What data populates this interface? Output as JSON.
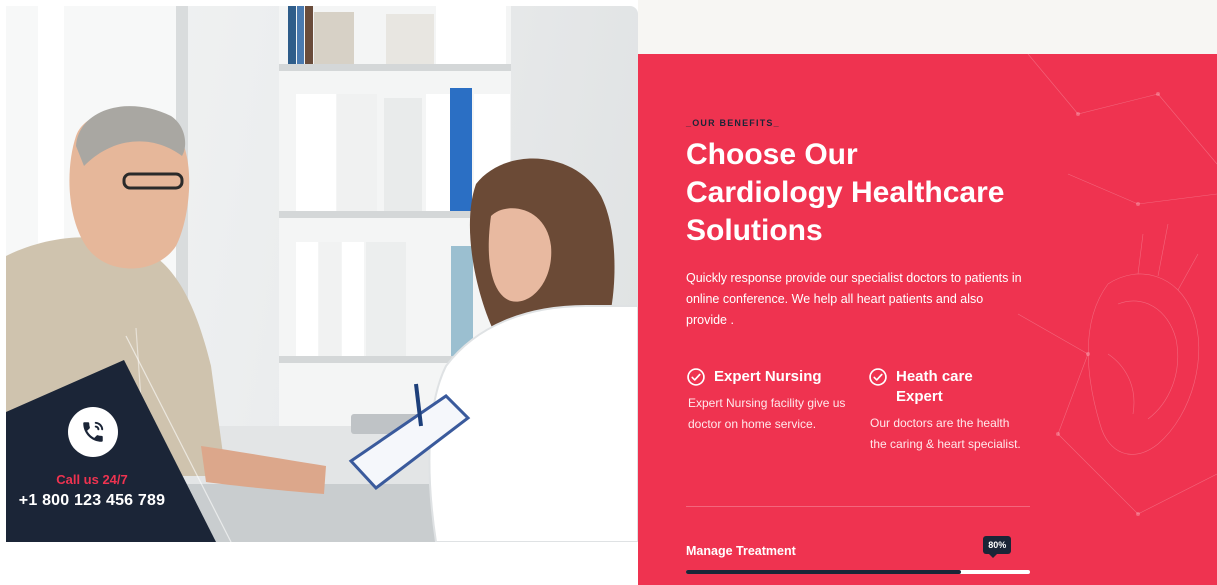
{
  "call": {
    "label": "Call us 24/7",
    "number": "+1 800 123 456 789",
    "icon": "phone-icon"
  },
  "benefits": {
    "eyebrow": "_OUR BENEFITS_",
    "headline_lines": [
      "Choose Our",
      "Cardiology Healthcare",
      "Solutions"
    ],
    "lead": "Quickly response provide our specialist doctors to patients in online conference. We help all heart patients and also provide .",
    "features": [
      {
        "icon": "check-circle-icon",
        "title": "Expert Nursing",
        "description": "Expert Nursing facility give us doctor on home service."
      },
      {
        "icon": "check-circle-icon",
        "title": "Heath care Expert",
        "description": "Our doctors are the health the caring & heart specialist."
      }
    ],
    "progress": {
      "label": "Manage Treatment",
      "value_text": "80%",
      "value": 80
    }
  },
  "colors": {
    "accent_red": "#ef3350",
    "navy": "#1b2537",
    "white": "#ffffff"
  }
}
